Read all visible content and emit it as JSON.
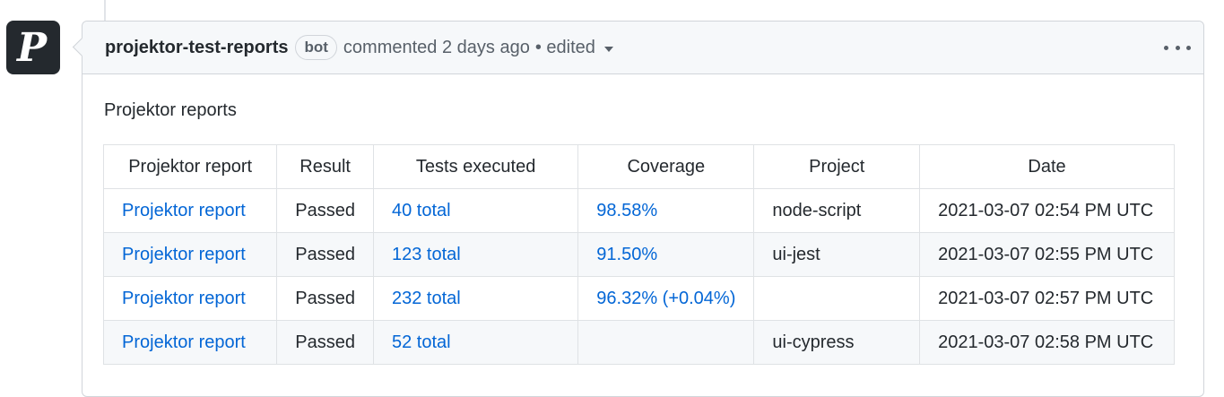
{
  "comment": {
    "avatar_letter": "P",
    "author": "projektor-test-reports",
    "badge": "bot",
    "meta": "commented 2 days ago",
    "edited_label": "• edited",
    "icons": {
      "edited_menu": "chevron-down-icon",
      "more_actions": "kebab-horizontal-icon"
    }
  },
  "report": {
    "title": "Projektor reports",
    "columns": [
      "Projektor report",
      "Result",
      "Tests executed",
      "Coverage",
      "Project",
      "Date"
    ],
    "rows": [
      {
        "report": "Projektor report",
        "result": "Passed",
        "tests": "40 total",
        "coverage": "98.58%",
        "project": "node-script",
        "date": "2021-03-07 02:54 PM UTC"
      },
      {
        "report": "Projektor report",
        "result": "Passed",
        "tests": "123 total",
        "coverage": "91.50%",
        "project": "ui-jest",
        "date": "2021-03-07 02:55 PM UTC"
      },
      {
        "report": "Projektor report",
        "result": "Passed",
        "tests": "232 total",
        "coverage": "96.32% (+0.04%)",
        "project": "",
        "date": "2021-03-07 02:57 PM UTC"
      },
      {
        "report": "Projektor report",
        "result": "Passed",
        "tests": "52 total",
        "coverage": "",
        "project": "ui-cypress",
        "date": "2021-03-07 02:58 PM UTC"
      }
    ]
  },
  "colors": {
    "link": "#0366d6",
    "text": "#24292e",
    "muted": "#586069",
    "header_bg": "#f6f8fa",
    "border": "#d1d5da",
    "avatar_bg": "#24292e"
  }
}
